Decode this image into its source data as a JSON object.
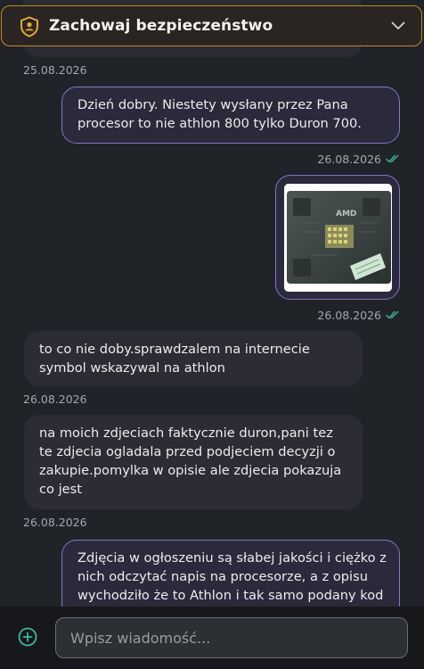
{
  "safety_banner": {
    "title": "Zachowaj bezpieczeństwo",
    "icon": "shield-person-icon",
    "expand_icon": "chevron-down-icon",
    "accent_color": "#c28a1e"
  },
  "messages": [
    {
      "direction": "incoming",
      "text": "",
      "timestamp": "25.08.2026"
    },
    {
      "direction": "outgoing",
      "text": "Dzień dobry. Niestety wysłany przez Pana procesor to nie athlon 800 tylko Duron 700.",
      "timestamp": "26.08.2026",
      "read": true
    },
    {
      "direction": "outgoing",
      "type": "image",
      "image_label": "AMD",
      "timestamp": "26.08.2026",
      "read": true
    },
    {
      "direction": "incoming",
      "text": "to co nie doby.sprawdzalem na internecie symbol wskazywal na athlon",
      "timestamp": "26.08.2026"
    },
    {
      "direction": "incoming",
      "text": "na moich zdjeciach faktycznie duron,pani tez te zdjecia ogladala przed podjeciem decyzji o zakupie.pomylka w opisie ale zdjecia pokazuja co jest",
      "timestamp": "26.08.2026"
    },
    {
      "direction": "outgoing",
      "text": "Zdjęcia w ogłoszeniu są słabej jakości i ciężko z nich odczytać napis na procesorze, a z opisu wychodziło że to Athlon i tak samo podany kod"
    }
  ],
  "composer": {
    "placeholder": "Wpisz wiadomość...",
    "value": "",
    "add_icon": "plus-circle-icon"
  },
  "colors": {
    "background": "#202328",
    "outgoing_border": "#7f78c8",
    "read_check": "#3fb7a0"
  }
}
